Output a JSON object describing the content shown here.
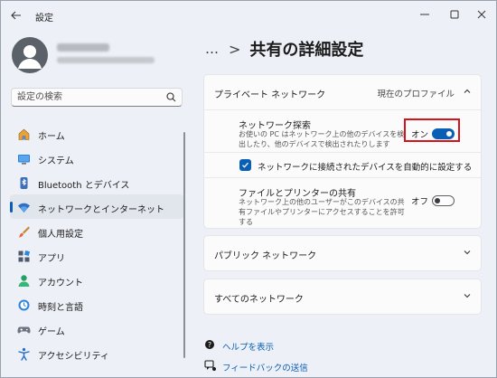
{
  "window": {
    "title": "設定"
  },
  "user": {
    "name": "",
    "email": ""
  },
  "search": {
    "placeholder": "設定の検索",
    "value": ""
  },
  "sidebar": {
    "items": [
      {
        "label": "ホーム",
        "icon": "home-icon",
        "active": false
      },
      {
        "label": "システム",
        "icon": "system-icon",
        "active": false
      },
      {
        "label": "Bluetooth とデバイス",
        "icon": "bluetooth-icon",
        "active": false
      },
      {
        "label": "ネットワークとインターネット",
        "icon": "wifi-icon",
        "active": true
      },
      {
        "label": "個人用設定",
        "icon": "brush-icon",
        "active": false
      },
      {
        "label": "アプリ",
        "icon": "apps-icon",
        "active": false
      },
      {
        "label": "アカウント",
        "icon": "account-icon",
        "active": false
      },
      {
        "label": "時刻と言語",
        "icon": "clock-globe-icon",
        "active": false
      },
      {
        "label": "ゲーム",
        "icon": "gamepad-icon",
        "active": false
      },
      {
        "label": "アクセシビリティ",
        "icon": "accessibility-icon",
        "active": false
      }
    ]
  },
  "header": {
    "more": "…",
    "separator": ">",
    "title": "共有の詳細設定"
  },
  "private_network": {
    "title": "プライベート ネットワーク",
    "status": "現在のプロファイル",
    "discovery": {
      "title": "ネットワーク探索",
      "description": "お使いの PC はネットワーク上の他のデバイスを検出したり、他のデバイスで検出されたりします",
      "state_label": "オン",
      "on": true
    },
    "auto_setup": {
      "label": "ネットワークに接続されたデバイスを自動的に設定する",
      "checked": true
    },
    "file_printer_sharing": {
      "title": "ファイルとプリンターの共有",
      "description": "ネットワーク上の他のユーザーがこのデバイスの共有ファイルやプリンターにアクセスすることを許可する",
      "state_label": "オフ",
      "on": false
    }
  },
  "public_network": {
    "title": "パブリック ネットワーク"
  },
  "all_networks": {
    "title": "すべてのネットワーク"
  },
  "footer": {
    "help": "ヘルプを表示",
    "feedback": "フィードバックの送信"
  },
  "colors": {
    "accent": "#0a5fb4",
    "highlight": "#d6121b",
    "background": "#edf0f6"
  }
}
